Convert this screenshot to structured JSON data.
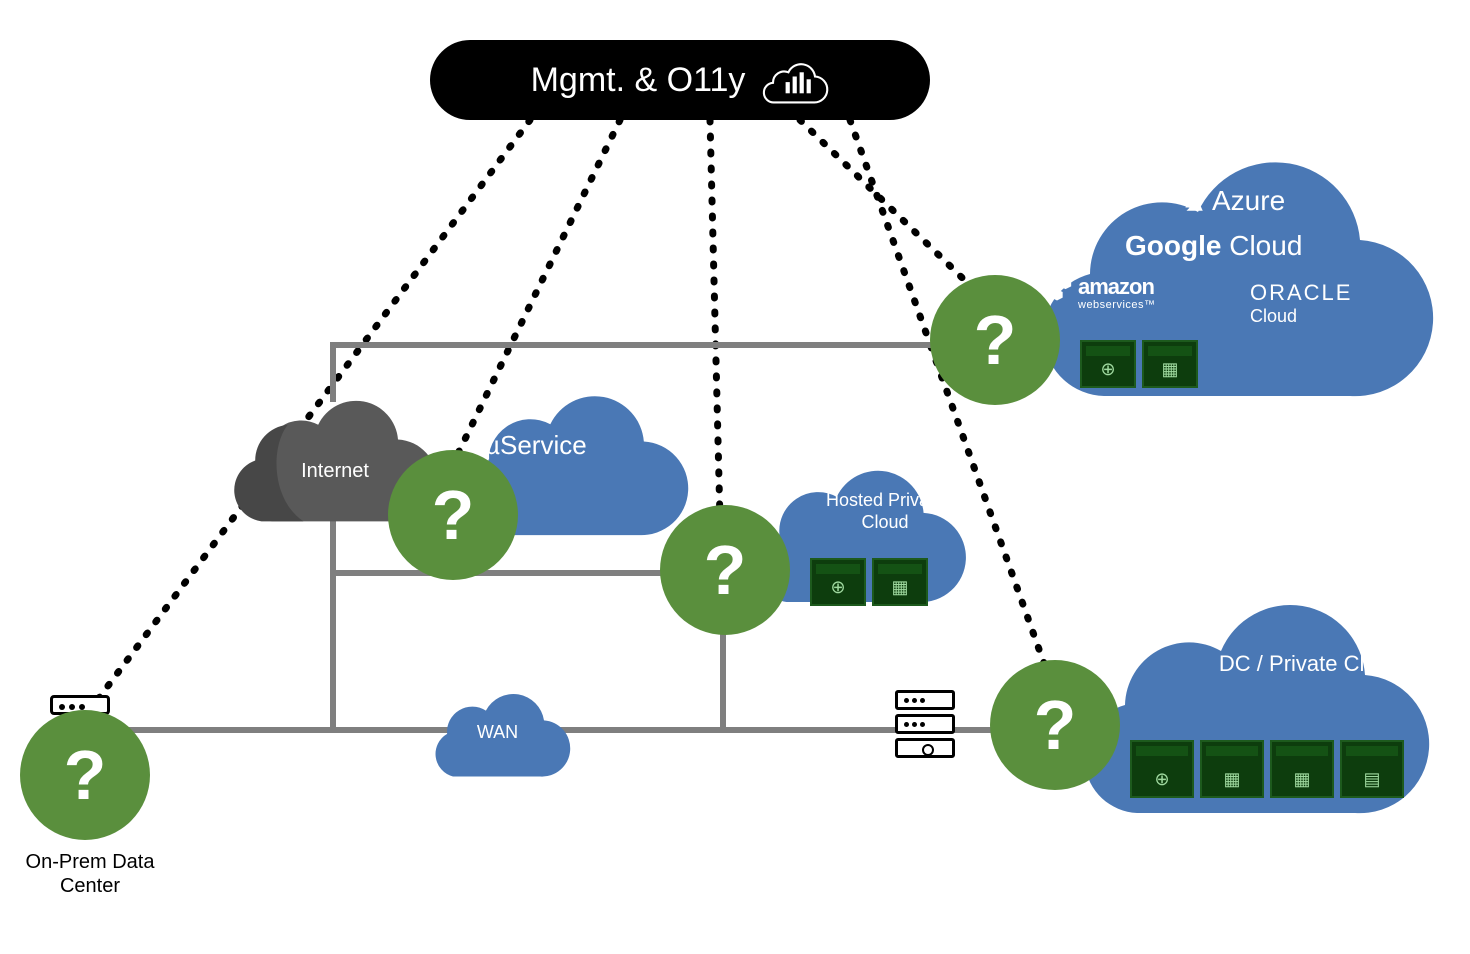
{
  "mgmt": {
    "label": "Mgmt. & O11y"
  },
  "nodes": {
    "internet": {
      "label": "Internet"
    },
    "microservice": {
      "label": "µService"
    },
    "hosted": {
      "label": "Hosted Private Cloud"
    },
    "wan": {
      "label": "WAN"
    },
    "dc": {
      "label": "DC / Private Cloud"
    },
    "onprem": {
      "label": "On-Prem Data Center"
    }
  },
  "providers": {
    "azure": "Azure",
    "google_bold": "Google",
    "google_light": " Cloud",
    "aws_line1": "amazon",
    "aws_line2": "webservices™",
    "oracle_line1": "ORACLE",
    "oracle_line2": "Cloud"
  },
  "question_mark": "?",
  "colors": {
    "cloud_blue": "#4a78b5",
    "cloud_grey": "#595959",
    "accent_green": "#5a8f3d",
    "line_grey": "#7f7f7f"
  }
}
